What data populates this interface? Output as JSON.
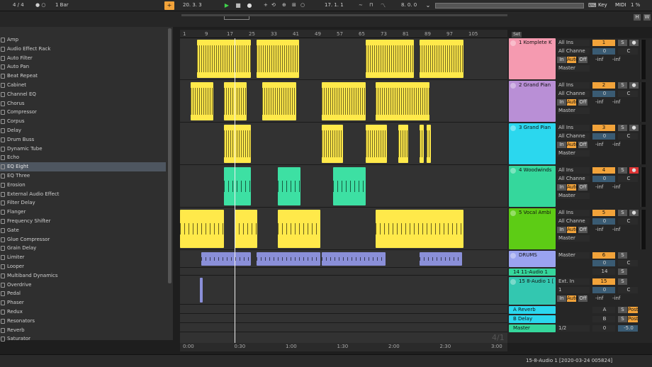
{
  "transport": {
    "signature": "4 / 4",
    "quantize": "1 Bar",
    "position": "20. 3. 3",
    "loop_start": "17. 1. 1",
    "loop_length": "8. 0. 0",
    "key_label": "Key",
    "midi_label": "MIDI",
    "cpu": "1 %",
    "io_h": "H",
    "io_w": "W"
  },
  "browser": {
    "items": [
      "Amp",
      "Audio Effect Rack",
      "Auto Filter",
      "Auto Pan",
      "Beat Repeat",
      "Cabinet",
      "Channel EQ",
      "Chorus",
      "Compressor",
      "Corpus",
      "Delay",
      "Drum Buss",
      "Dynamic Tube",
      "Echo",
      "EQ Eight",
      "EQ Three",
      "Erosion",
      "External Audio Effect",
      "Filter Delay",
      "Flanger",
      "Frequency Shifter",
      "Gate",
      "Glue Compressor",
      "Grain Delay",
      "Limiter",
      "Looper",
      "Multiband Dynamics",
      "Overdrive",
      "Pedal",
      "Phaser",
      "Redux",
      "Resonators",
      "Reverb",
      "Saturator"
    ],
    "selected_index": 14
  },
  "ruler": {
    "bars": [
      "1",
      "9",
      "17",
      "25",
      "33",
      "41",
      "49",
      "57",
      "65",
      "73",
      "81",
      "89",
      "97",
      "105"
    ],
    "times": [
      "0:00",
      "0:30",
      "1:00",
      "1:30",
      "2:00",
      "2:30",
      "3:00"
    ],
    "page": "4/1"
  },
  "set_label": "Set",
  "tracks": [
    {
      "name": "1 Komplete K",
      "color": "#f59ab0",
      "input": "All Ins",
      "channel": "All Channe",
      "monitor": [
        "In",
        "Auto",
        "Off"
      ],
      "out": "Master",
      "num": "1",
      "vol": "0",
      "pan": "C",
      "l": "-inf",
      "r": "-inf",
      "lane_color": "#ffe94a"
    },
    {
      "name": "2 Grand Pian",
      "color": "#b98fd6",
      "input": "All Ins",
      "channel": "All Channe",
      "monitor": [
        "In",
        "Auto",
        "Off"
      ],
      "out": "Master",
      "num": "2",
      "vol": "0",
      "pan": "C",
      "l": "-inf",
      "r": "-inf",
      "lane_color": "#ffe94a"
    },
    {
      "name": "3 Grand Pian",
      "color": "#2bd7ee",
      "input": "All Ins",
      "channel": "All Channe",
      "monitor": [
        "In",
        "Auto",
        "Off"
      ],
      "out": "Master",
      "num": "3",
      "vol": "0",
      "pan": "C",
      "l": "-inf",
      "r": "-inf",
      "lane_color": "#ffe94a"
    },
    {
      "name": "4 Woodwinds",
      "color": "#35d79c",
      "input": "All Ins",
      "channel": "All Channe",
      "monitor": [
        "In",
        "Auto",
        "Off"
      ],
      "out": "Master",
      "num": "4",
      "vol": "0",
      "pan": "C",
      "l": "-inf",
      "r": "-inf",
      "lane_color": "#3de0a3"
    },
    {
      "name": "5 Vocal Ambi",
      "color": "#5dcc15",
      "input": "All Ins",
      "channel": "All Channe",
      "monitor": [
        "In",
        "Auto",
        "Off"
      ],
      "out": "Master",
      "num": "5",
      "vol": "0",
      "pan": "C",
      "l": "-inf",
      "r": "-inf",
      "lane_color": "#ffe94a"
    }
  ],
  "drums": {
    "name": "DRUMS",
    "color": "#9aa3f0",
    "out": "Master",
    "num": "6",
    "vol": "0",
    "pan": "C"
  },
  "audio14": {
    "name": "14 11-Audio 1",
    "color": "#35d79c",
    "num": "14"
  },
  "audio15": {
    "name": "15 8-Audio 1 [",
    "color": "#33c7b0",
    "input": "Ext. In",
    "channel": "1",
    "monitor": [
      "In",
      "Auto",
      "Off"
    ],
    "num": "15",
    "vol": "0",
    "pan": "C",
    "l": "-inf",
    "r": "-inf"
  },
  "returns": [
    {
      "name": "A Reverb",
      "color": "#2bd7ee",
      "letter": "A",
      "send": "Post"
    },
    {
      "name": "B Delay",
      "color": "#2bd7ee",
      "letter": "B",
      "send": "Post"
    }
  ],
  "master": {
    "name": "Master",
    "color": "#35d79c",
    "out": "1/2",
    "num": "0",
    "vol": "-5.0"
  },
  "status": {
    "text": "15-8-Audio 1 [2020-03-24 005824]"
  }
}
